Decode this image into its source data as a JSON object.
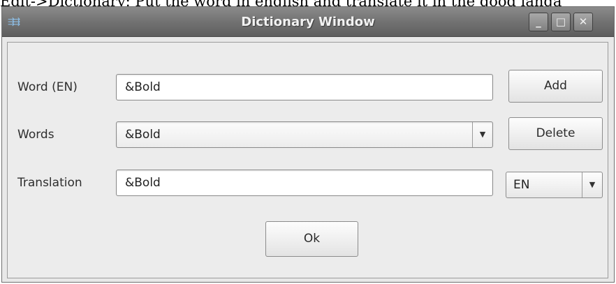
{
  "caption": "Edit->Dictionary: Put the word in english and translate it in the good langa",
  "window": {
    "title": "Dictionary Window",
    "icon": "app-icon",
    "controls": {
      "minimize": "_",
      "maximize": "□",
      "close": "✕"
    }
  },
  "form": {
    "word_label": "Word (EN)",
    "word_value": "&Bold",
    "words_label": "Words",
    "words_selected": "&Bold",
    "translation_label": "Translation",
    "translation_value": "&Bold",
    "language_selected": "EN"
  },
  "buttons": {
    "add": "Add",
    "delete": "Delete",
    "ok": "Ok"
  },
  "icons": {
    "dropdown": "▼"
  }
}
